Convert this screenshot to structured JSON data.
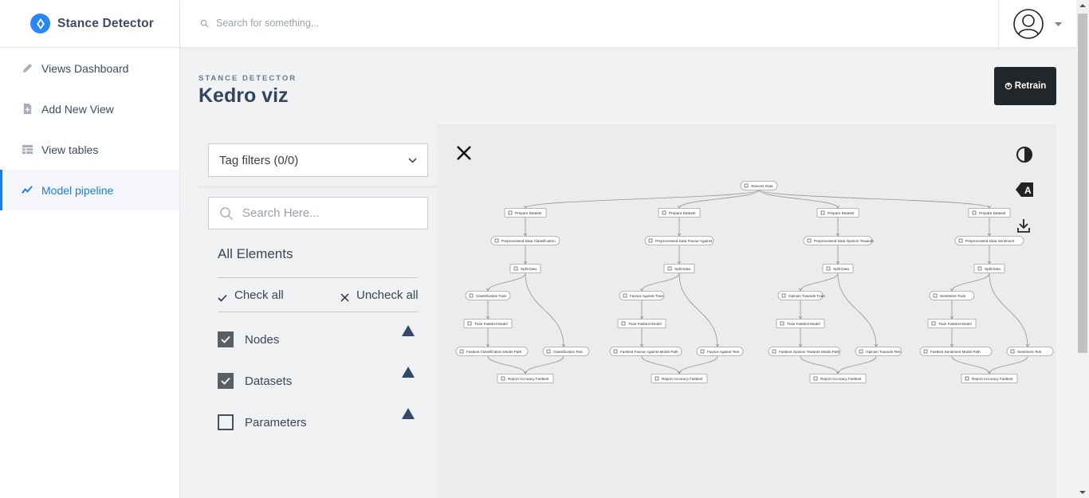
{
  "brand": {
    "name": "Stance Detector",
    "accent": "#2a85f5"
  },
  "nav": [
    {
      "label": "Views Dashboard",
      "icon": "pencil-icon",
      "active": false
    },
    {
      "label": "Add New View",
      "icon": "file-plus-icon",
      "active": false
    },
    {
      "label": "View tables",
      "icon": "table-icon",
      "active": false
    },
    {
      "label": "Model pipeline",
      "icon": "trend-line-icon",
      "active": true
    }
  ],
  "topbar": {
    "search_placeholder": "Search for something..."
  },
  "page": {
    "kicker": "STANCE DETECTOR",
    "title": "Kedro viz",
    "retrain_label": "Retrain"
  },
  "kedro": {
    "tag_filter_label": "Tag filters (0/0)",
    "search_placeholder": "Search Here...",
    "all_elements": "All Elements",
    "check_all": "Check all",
    "uncheck_all": "Uncheck all",
    "elements": [
      {
        "label": "Nodes",
        "checked": true
      },
      {
        "label": "Datasets",
        "checked": true
      },
      {
        "label": "Parameters",
        "checked": false
      }
    ],
    "toolbar_icons": [
      "theme-toggle-icon",
      "label-toggle-icon",
      "export-icon"
    ],
    "graph": {
      "root": "Stances Data",
      "columns": [
        {
          "prepare": "Prepare Dataset",
          "preprocessed": "Preprocessed Data Classification",
          "split": "Split Data",
          "train": "Classification Train",
          "model": "Train Fasttext Model",
          "model_path": "Fasttext Classification Model Path",
          "test": "Classification Test",
          "report": "Report Accuracy Fasttext"
        },
        {
          "prepare": "Prepare Dataset",
          "preprocessed": "Preprocessed Data Favour Against",
          "split": "Split Data",
          "train": "Favour Against Train",
          "model": "Train Fasttext Model",
          "model_path": "Fasttext Favour Against Model Path",
          "test": "Favour Against Test",
          "report": "Report Accuracy Fasttext"
        },
        {
          "prepare": "Prepare Dataset",
          "preprocessed": "Preprocessed Data Opinion Towards",
          "split": "Split Data",
          "train": "Opinion Towards Train",
          "model": "Train Fasttext Model",
          "model_path": "Fasttext Opinion Towards Model Path",
          "test": "Opinion Towards Test",
          "report": "Report Accuracy Fasttext"
        },
        {
          "prepare": "Prepare Dataset",
          "preprocessed": "Preprocessed Data Sentiment",
          "split": "Split Data",
          "train": "Sentiment Train",
          "model": "Train Fasttext Model",
          "model_path": "Fasttext Sentiment Model Path",
          "test": "Sentiment Test",
          "report": "Report Accuracy Fasttext"
        }
      ]
    }
  }
}
